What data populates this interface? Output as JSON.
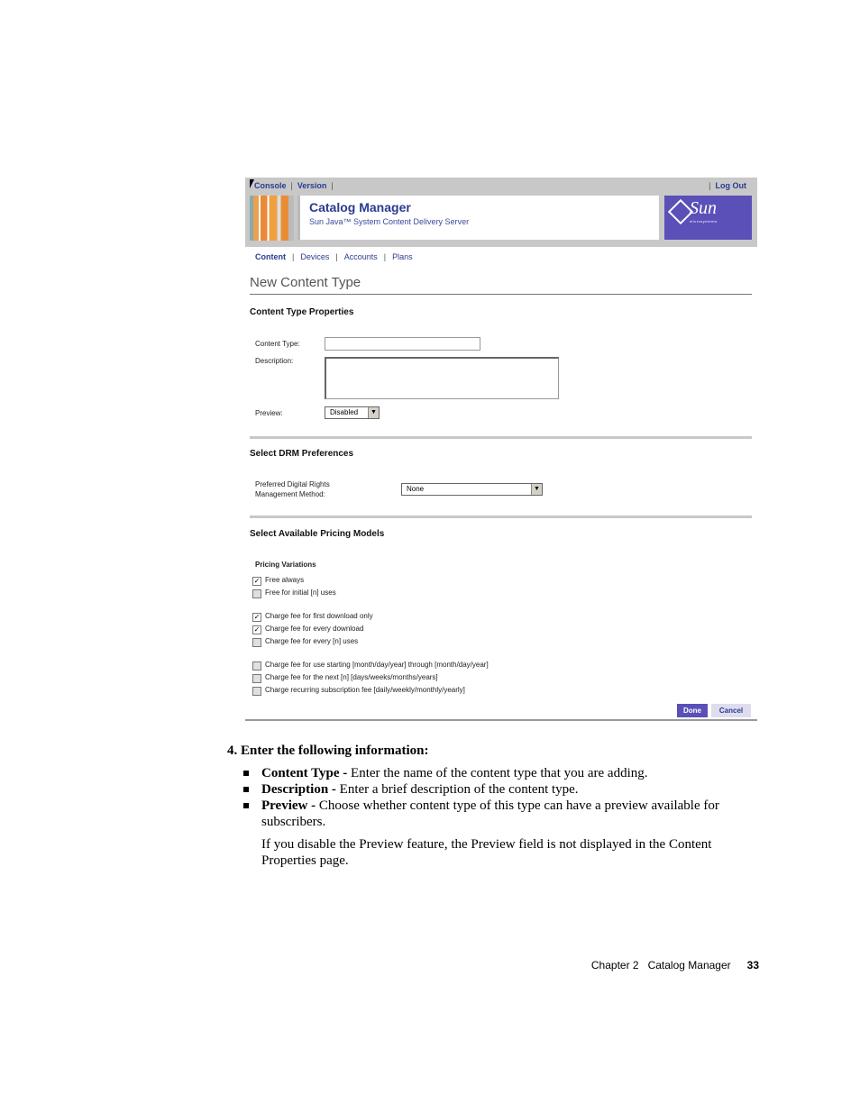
{
  "app": {
    "top_links": [
      "Console",
      "Version"
    ],
    "logout": "Log Out",
    "title": "Catalog Manager",
    "subtitle": "Sun Java™ System Content Delivery Server",
    "logo_word": "Sun",
    "logo_micro": "microsystems",
    "tabs": [
      "Content",
      "Devices",
      "Accounts",
      "Plans"
    ],
    "page_title": "New Content Type",
    "section_properties": "Content Type Properties",
    "label_content_type": "Content Type:",
    "label_description": "Description:",
    "label_preview": "Preview:",
    "preview_value": "Disabled",
    "section_drm": "Select DRM Preferences",
    "label_drm": "Preferred Digital Rights Management Method:",
    "drm_value": "None",
    "section_pricing": "Select Available Pricing Models",
    "pricing_variations": "Pricing Variations",
    "pricing_options": [
      {
        "label": "Free always",
        "checked": true
      },
      {
        "label": "Free for initial [n] uses",
        "checked": false
      },
      {
        "label": "Charge fee for first download only",
        "checked": true
      },
      {
        "label": "Charge fee for every download",
        "checked": true
      },
      {
        "label": "Charge fee for every [n] uses",
        "checked": false
      },
      {
        "label": "Charge fee for use starting [month/day/year] through [month/day/year]",
        "checked": false
      },
      {
        "label": "Charge fee for the next [n] [days/weeks/months/years]",
        "checked": false
      },
      {
        "label": "Charge recurring subscription fee [daily/weekly/monthly/yearly]",
        "checked": false
      }
    ],
    "done": "Done",
    "cancel": "Cancel"
  },
  "doc": {
    "step": "4.  Enter the following information:",
    "bullets": [
      {
        "term": "Content Type -",
        "text": " Enter the name of the content type that you are adding."
      },
      {
        "term": "Description -",
        "text": " Enter a brief description of the content type."
      },
      {
        "term": "Preview -",
        "text": " Choose whether content type of this type can have a preview available for subscribers."
      }
    ],
    "para": "If you disable the Preview feature, the Preview field is not displayed in the Content Properties page.",
    "footer_chapter": "Chapter 2   Catalog Manager",
    "footer_page": "33"
  }
}
